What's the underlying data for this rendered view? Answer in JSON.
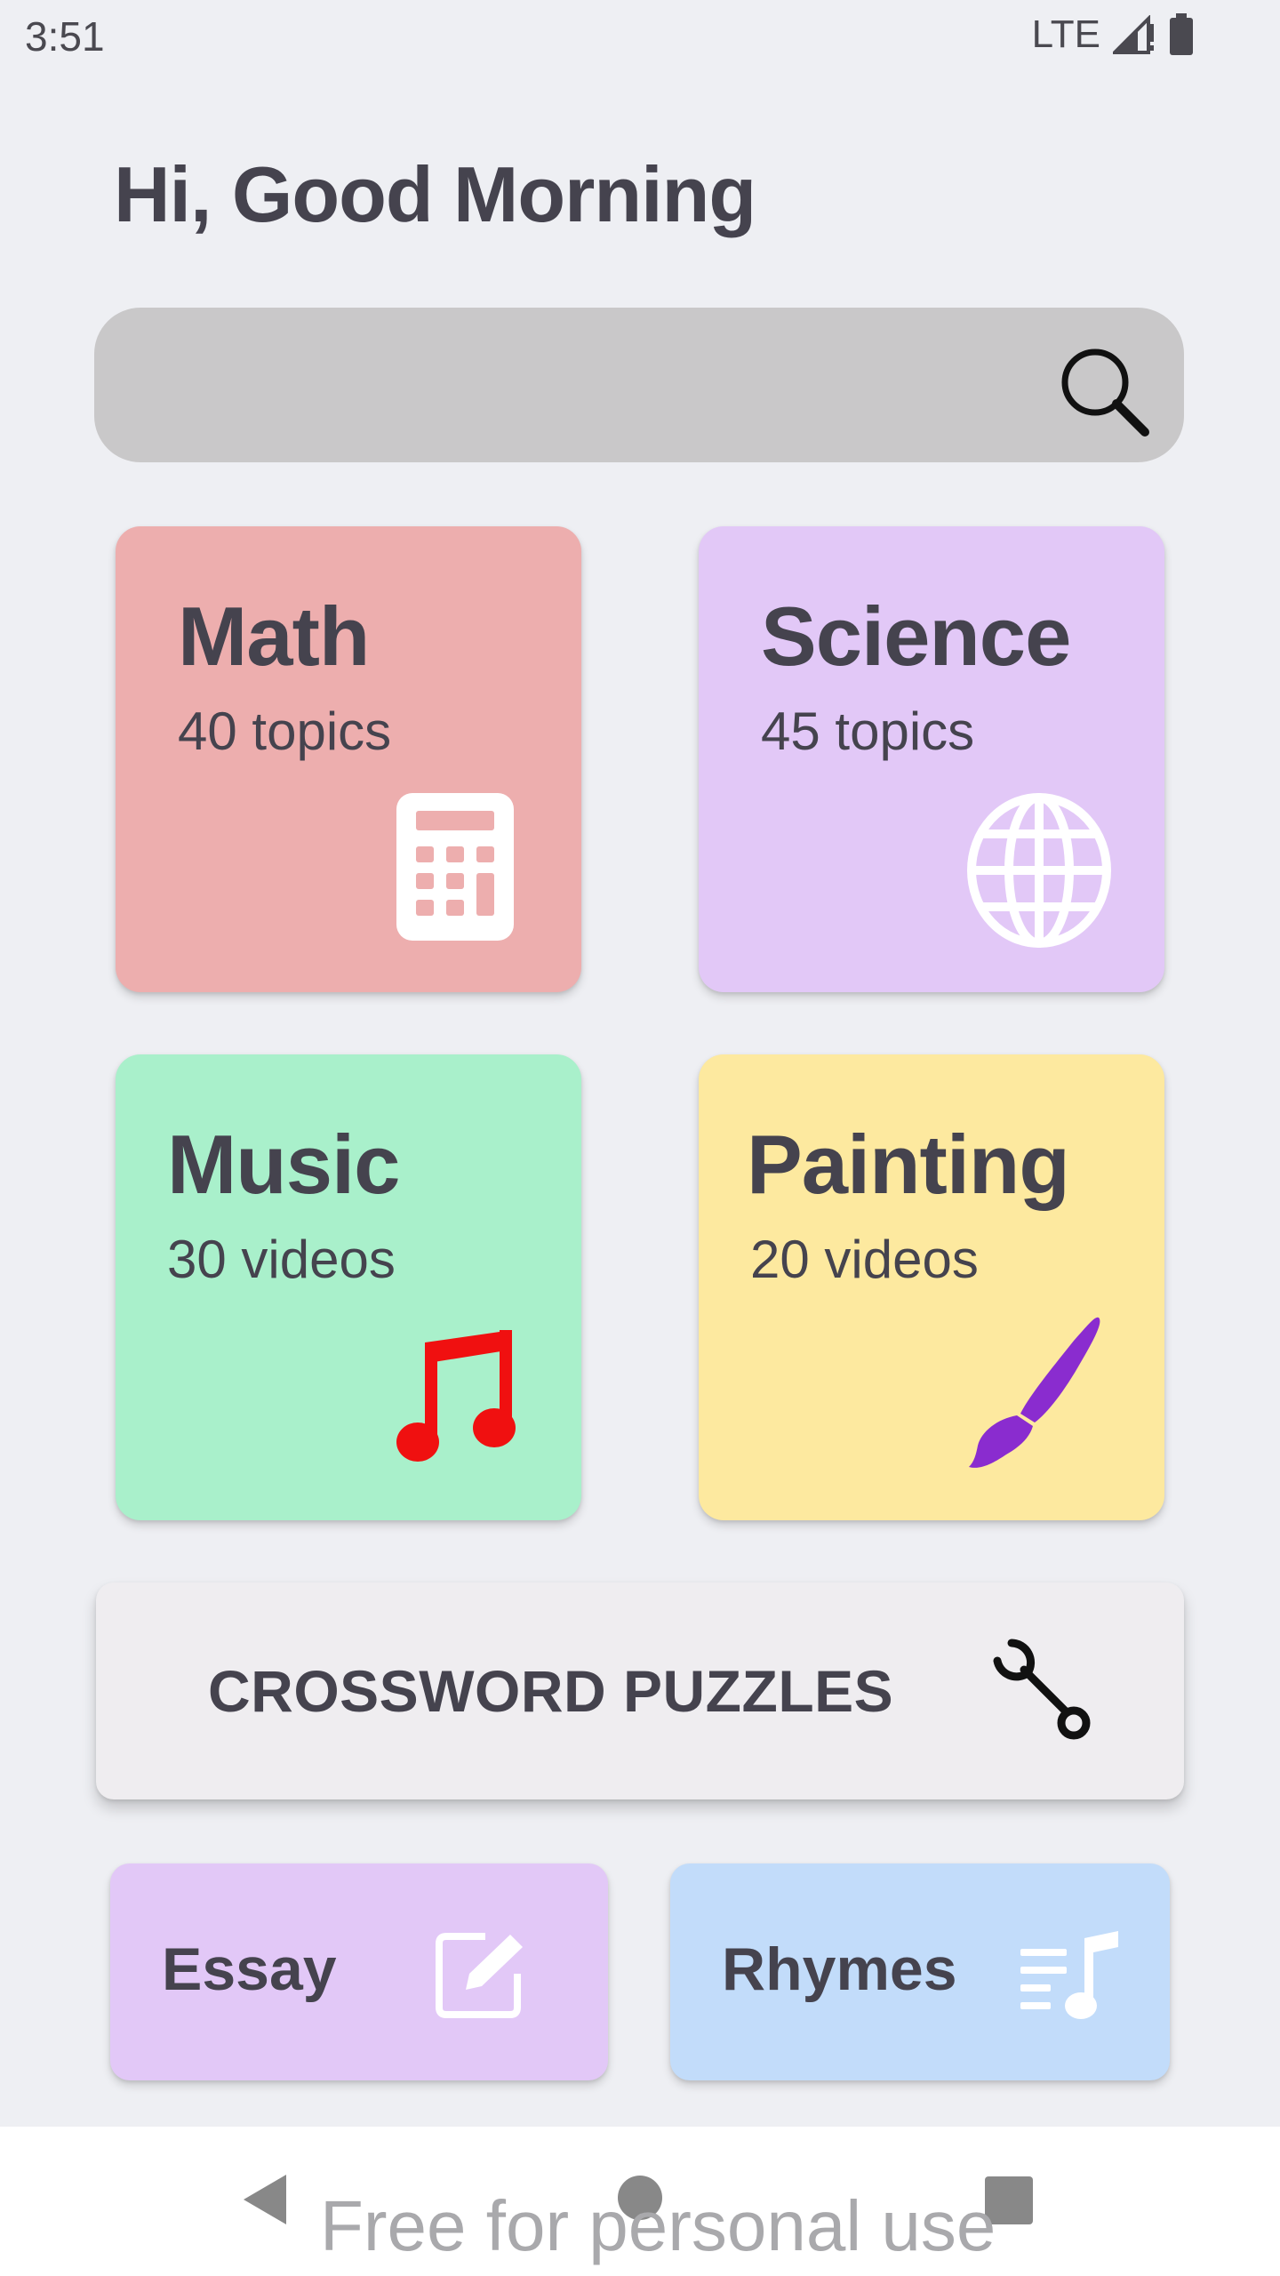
{
  "status_bar": {
    "time": "3:51",
    "network": "LTE",
    "icons": [
      "signal-icon",
      "battery-icon"
    ]
  },
  "greeting": "Hi, Good Morning",
  "search": {
    "value": "",
    "placeholder": "",
    "icon": "search-icon"
  },
  "cards": [
    {
      "title": "Math",
      "subtitle": "40 topics",
      "icon": "calculator-icon",
      "color": "#edaeae"
    },
    {
      "title": "Science",
      "subtitle": "45 topics",
      "icon": "globe-icon",
      "color": "#e2c8f7"
    },
    {
      "title": "Music",
      "subtitle": "30 videos",
      "icon": "music-note-icon",
      "color": "#a9f0cb"
    },
    {
      "title": "Painting",
      "subtitle": "20 videos",
      "icon": "paintbrush-icon",
      "color": "#fde99f"
    }
  ],
  "crossword": {
    "label": "CROSSWORD PUZZLES",
    "icon": "wrench-icon",
    "color": "#efedf0"
  },
  "small_cards": [
    {
      "label": "Essay",
      "icon": "edit-icon",
      "color": "#e2c8f7"
    },
    {
      "label": "Rhymes",
      "icon": "playlist-music-icon",
      "color": "#c2dcfa"
    }
  ],
  "nav_bar": {
    "buttons": [
      "back-icon",
      "home-icon",
      "recents-icon"
    ],
    "watermark": "Free for personal use"
  },
  "colors": {
    "background": "#eeeff3",
    "text": "#45434e",
    "music_note": "#f01010",
    "paintbrush": "#8a2ccf"
  }
}
